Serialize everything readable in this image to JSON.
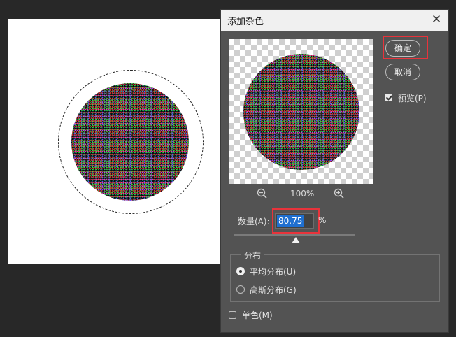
{
  "dialog": {
    "title": "添加杂色",
    "close_glyph": "✕",
    "ok_label": "确定",
    "cancel_label": "取消",
    "preview_label": "预览(P)",
    "preview_checked": true,
    "zoom_out_icon": "zoom-out-icon",
    "zoom_in_icon": "zoom-in-icon",
    "zoom_level": "100%",
    "amount_label": "数量(A):",
    "amount_value": "80.75",
    "amount_unit": "%",
    "distribution": {
      "title": "分布",
      "uniform_label": "平均分布(U)",
      "gaussian_label": "高斯分布(G)",
      "selected": "uniform"
    },
    "monochromatic_label": "单色(M)",
    "monochromatic_checked": false
  },
  "colors": {
    "highlight": "#e8333b",
    "dialog_bg": "#535353",
    "selection_blue": "#1f6fd0"
  }
}
